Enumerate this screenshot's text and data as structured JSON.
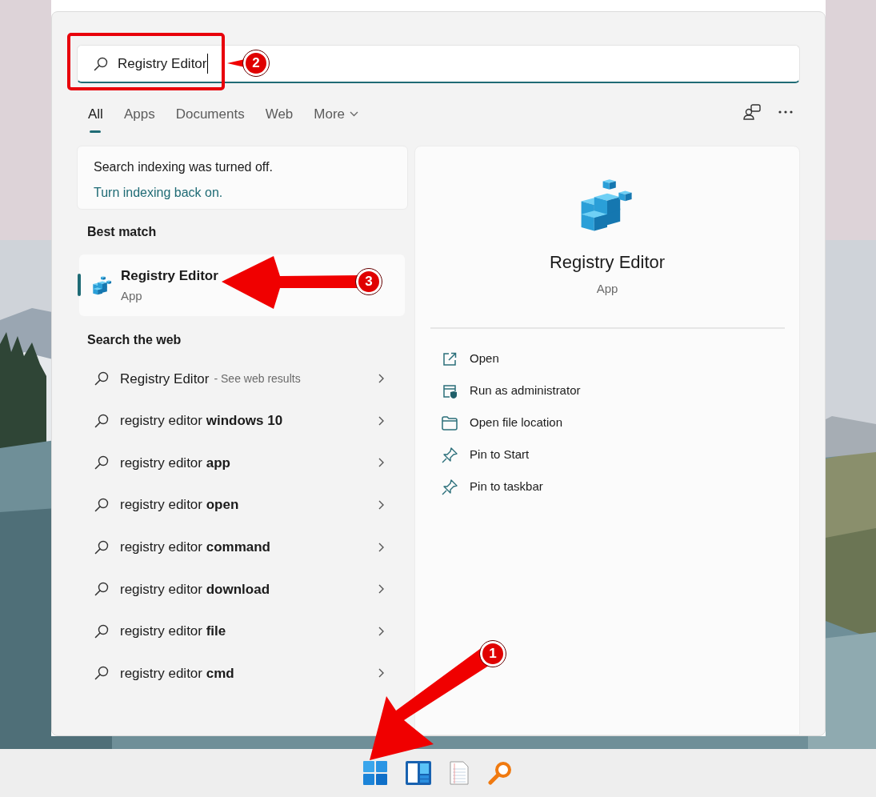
{
  "search": {
    "value": "Registry Editor"
  },
  "tabs": [
    {
      "label": "All",
      "selected": true,
      "has_menu": false
    },
    {
      "label": "Apps",
      "selected": false,
      "has_menu": false
    },
    {
      "label": "Documents",
      "selected": false,
      "has_menu": false
    },
    {
      "label": "Web",
      "selected": false,
      "has_menu": false
    },
    {
      "label": "More",
      "selected": false,
      "has_menu": true
    }
  ],
  "notice": {
    "text": "Search indexing was turned off.",
    "link": "Turn indexing back on."
  },
  "best_match": {
    "heading": "Best match",
    "name": "Registry Editor",
    "type": "App",
    "selected": true
  },
  "web": {
    "heading": "Search the web",
    "items": [
      {
        "text": "Registry Editor",
        "hint": "- See web results"
      },
      {
        "text": "registry editor **windows 10**"
      },
      {
        "text": "registry editor **app**"
      },
      {
        "text": "registry editor **open**"
      },
      {
        "text": "registry editor **command**"
      },
      {
        "text": "registry editor **download**"
      },
      {
        "text": "registry editor **file**"
      },
      {
        "text": "registry editor **cmd**"
      }
    ]
  },
  "detail": {
    "name": "Registry Editor",
    "type": "App",
    "actions": [
      {
        "label": "Open",
        "kind": "open"
      },
      {
        "label": "Run as administrator",
        "kind": "admin"
      },
      {
        "label": "Open file location",
        "kind": "folder"
      },
      {
        "label": "Pin to Start",
        "kind": "pin"
      },
      {
        "label": "Pin to taskbar",
        "kind": "pin"
      }
    ]
  },
  "taskbar": [
    {
      "kind": "start"
    },
    {
      "kind": "widgets"
    },
    {
      "kind": "notepad"
    },
    {
      "kind": "search"
    }
  ],
  "annotations": [
    {
      "label": "1"
    },
    {
      "label": "2"
    },
    {
      "label": "3"
    }
  ]
}
